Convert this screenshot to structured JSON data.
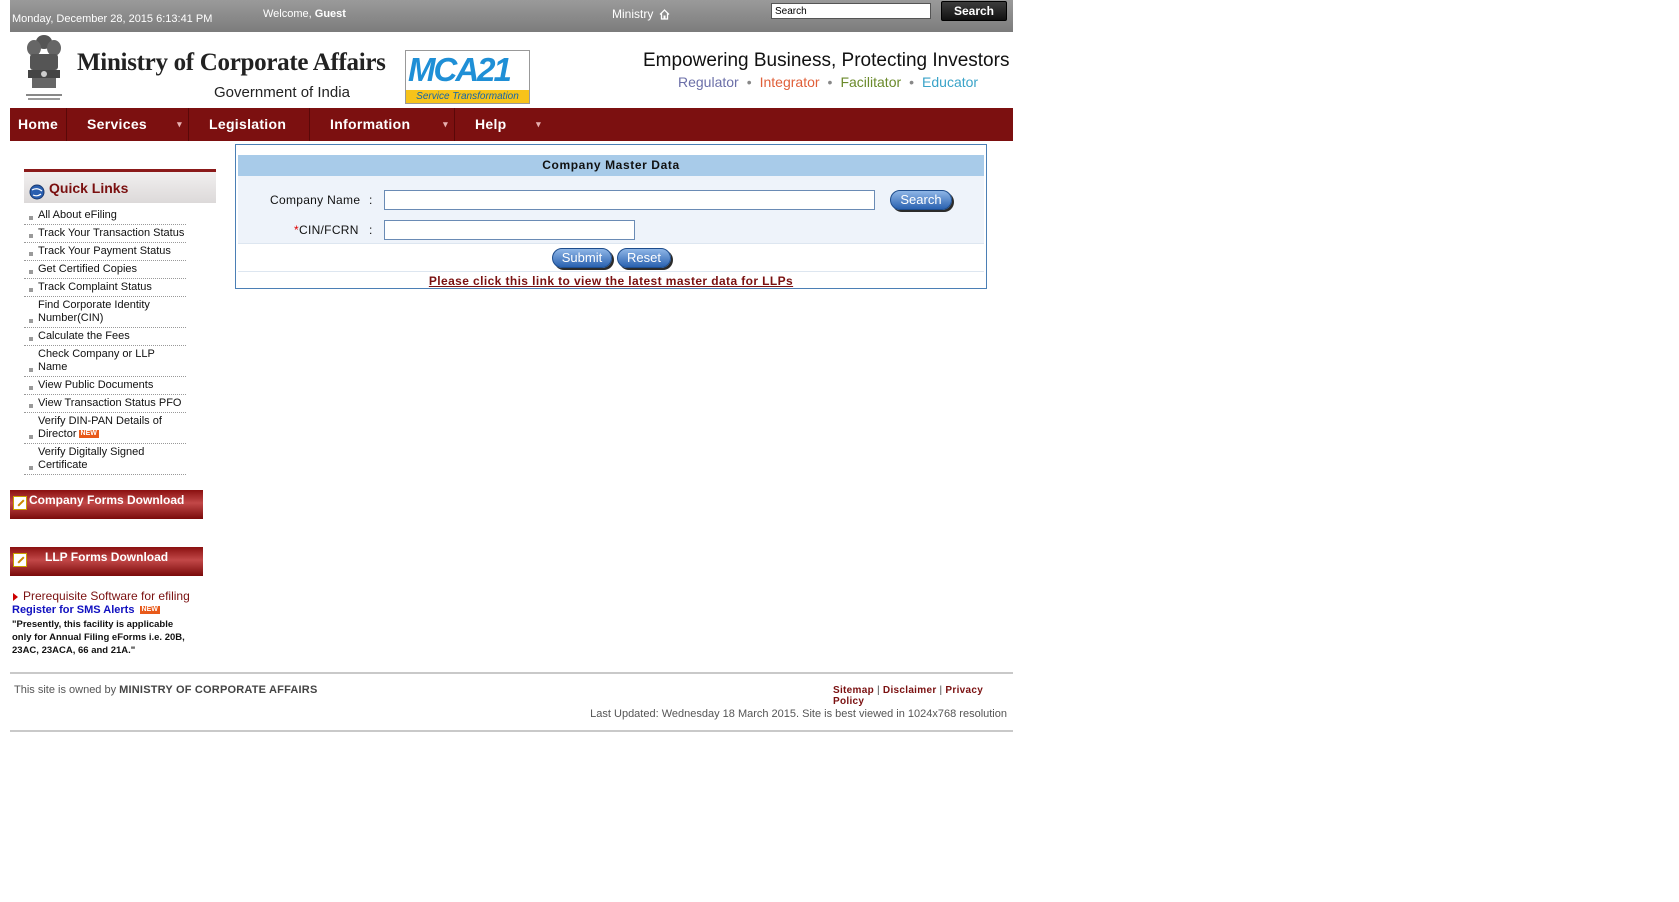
{
  "topbar": {
    "date": "Monday, December 28, 2015 6:13:41 PM",
    "welcome_prefix": "Welcome,",
    "welcome_user": "Guest",
    "ministry_label": "Ministry",
    "search_value": "Search",
    "search_button": "Search"
  },
  "header": {
    "org_title": "Ministry of Corporate Affairs",
    "org_subtitle": "Government of India",
    "mca_logo_text": "MCA21",
    "mca_logo_strip": "Service Transformation",
    "tagline": "Empowering Business, Protecting Investors",
    "roles": [
      "Regulator",
      "Integrator",
      "Facilitator",
      "Educator"
    ],
    "role_colors": [
      "#6b6fa8",
      "#e0603a",
      "#6a8a2a",
      "#3aa3c8"
    ]
  },
  "nav": {
    "items": [
      {
        "label": "Home"
      },
      {
        "label": "Services"
      },
      {
        "label": "Legislation"
      },
      {
        "label": "Information"
      },
      {
        "label": "Help"
      }
    ]
  },
  "quick_links": {
    "title": "Quick Links",
    "items": [
      "All About eFiling",
      "Track Your Transaction Status",
      "Track Your Payment Status",
      "Get Certified Copies",
      "Track Complaint Status",
      "Find Corporate Identity Number(CIN)",
      "Calculate the Fees",
      "Check Company or LLP Name",
      "View Public Documents",
      "View Transaction Status PFO",
      "Verify DIN-PAN Details of Director",
      "Verify Digitally Signed Certificate"
    ],
    "new_badge": "NEW"
  },
  "downloads": {
    "company_forms": "Company Forms Download",
    "llp_forms": "LLP Forms Download"
  },
  "sidebar_extra": {
    "prereq": "Prerequisite Software for efiling",
    "sms": "Register for SMS Alerts",
    "sms_badge": "NEW",
    "sms_note": "\"Presently, this facility is applicable only for Annual Filing eForms i.e. 20B, 23AC, 23ACA, 66 and 21A.\""
  },
  "form": {
    "title": "Company Master Data",
    "company_name_label": "Company Name",
    "cin_required_mark": "*",
    "cin_label": "CIN/FCRN",
    "colon": ":",
    "company_name_value": "",
    "cin_value": "",
    "search_button": "Search",
    "submit_button": "Submit",
    "reset_button": "Reset",
    "llp_link": "Please click this link to view the latest master data for LLPs"
  },
  "footer": {
    "owner_prefix": "This site is owned by",
    "owner_name": "MINISTRY OF CORPORATE AFFAIRS",
    "links": [
      "Sitemap",
      "Disclaimer",
      "Privacy Policy"
    ],
    "separator": "|",
    "updated": "Last Updated: Wednesday 18 March 2015. Site is best viewed in 1024x768 resolution"
  }
}
